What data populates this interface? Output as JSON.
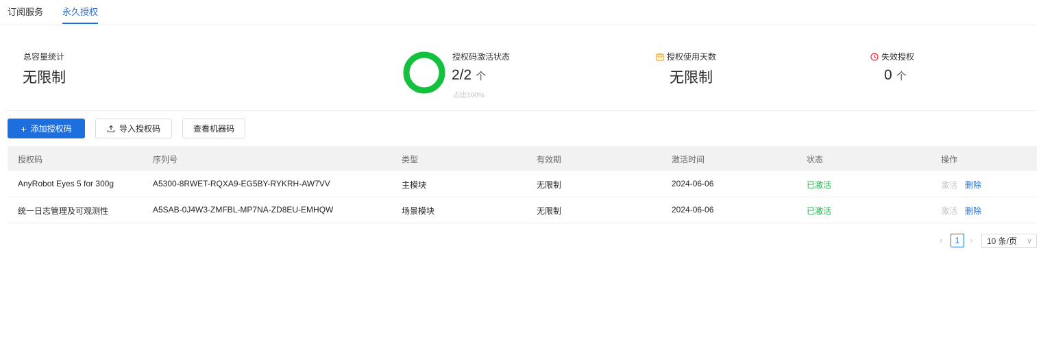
{
  "tabs": [
    {
      "label": "订阅服务",
      "active": false
    },
    {
      "label": "永久授权",
      "active": true
    }
  ],
  "stats": {
    "capacity": {
      "label": "总容量统计",
      "value": "无限制"
    },
    "activation": {
      "label": "授权码激活状态",
      "value": "2/2",
      "unit": "个",
      "ratio_text": "占比100%",
      "ratio": 1.0,
      "ring_color": "#13c13f"
    },
    "days": {
      "label": "授权使用天数",
      "value": "无限制",
      "icon": "calendar-icon",
      "icon_color": "#f5a623"
    },
    "invalid": {
      "label": "失效授权",
      "value": "0",
      "unit": "个",
      "icon": "clock-icon",
      "icon_color": "#f5222d"
    }
  },
  "toolbar": {
    "add_label": "添加授权码",
    "import_label": "导入授权码",
    "machine_label": "查看机器码"
  },
  "table": {
    "columns": [
      "授权码",
      "序列号",
      "类型",
      "有效期",
      "激活时间",
      "状态",
      "操作"
    ],
    "rows": [
      {
        "name": "AnyRobot Eyes 5 for 300g",
        "serial": "A5300-8RWET-RQXA9-EG5BY-RYKRH-AW7VV",
        "type": "主模块",
        "validity": "无限制",
        "activated_at": "2024-06-06",
        "status": "已激活",
        "actions": [
          "激活",
          "删除"
        ]
      },
      {
        "name": "统一日志管理及可观测性",
        "serial": "A5SAB-0J4W3-ZMFBL-MP7NA-ZD8EU-EMHQW",
        "type": "场景模块",
        "validity": "无限制",
        "activated_at": "2024-06-06",
        "status": "已激活",
        "actions": [
          "激活",
          "删除"
        ]
      }
    ]
  },
  "pagination": {
    "current": "1",
    "page_size": "10 条/页"
  },
  "colors": {
    "primary": "#1d6fe0",
    "success": "#23b14d"
  }
}
